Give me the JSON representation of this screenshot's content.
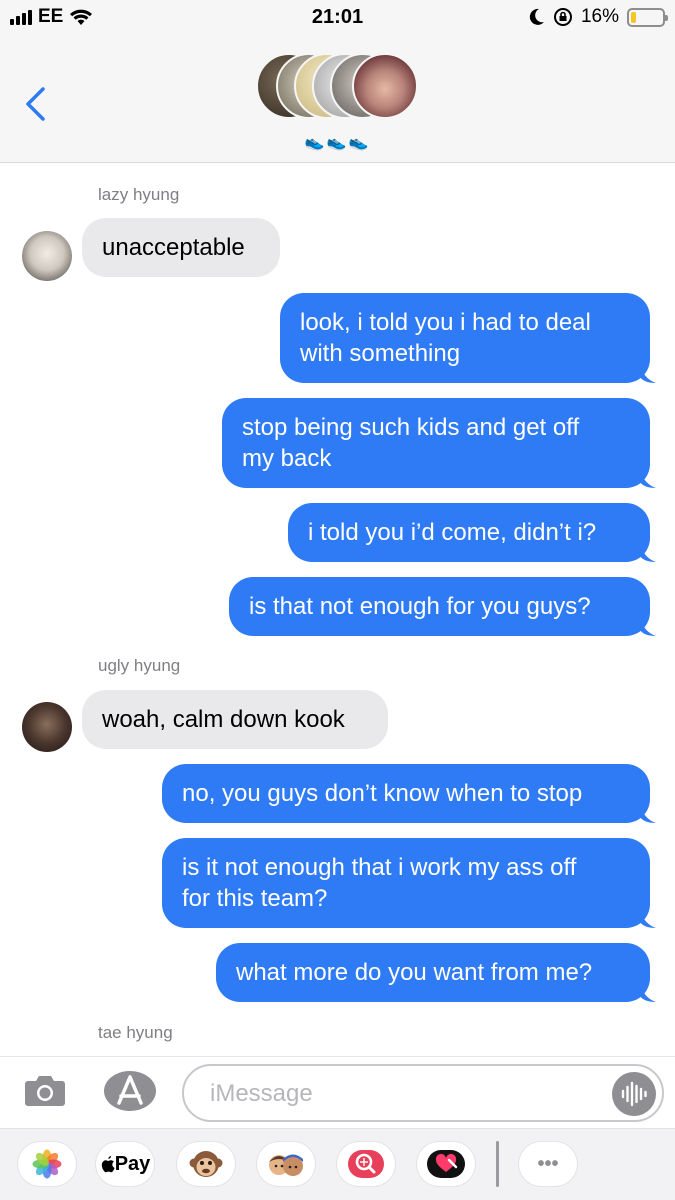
{
  "status_bar": {
    "carrier": "EE",
    "time": "21:01",
    "battery": "16%",
    "battery_level": 0.16
  },
  "header": {
    "group_emoji": "👟👟👟"
  },
  "messages": [
    {
      "sender": "lazy hyung"
    },
    {
      "dir": "in",
      "text": "unacceptable"
    },
    {
      "dir": "out",
      "text": "look, i told you i had to deal\nwith something"
    },
    {
      "dir": "out",
      "text": "stop being such kids and get off\nmy back"
    },
    {
      "dir": "out",
      "text": "i told you i’d come, didn’t i?"
    },
    {
      "dir": "out",
      "text": "is that not enough for you guys?"
    },
    {
      "sender": "ugly hyung"
    },
    {
      "dir": "in",
      "text": "woah, calm down kook"
    },
    {
      "dir": "out",
      "text": "no, you guys don’t know when to stop"
    },
    {
      "dir": "out",
      "text": "is it not enough that i work my ass off\nfor this team?"
    },
    {
      "dir": "out",
      "text": "what more do you want from me?"
    },
    {
      "sender": "tae hyung"
    }
  ],
  "input": {
    "placeholder": "iMessage"
  },
  "drawer": {
    "apple_pay_label": "Pay",
    "more_label": "•••"
  },
  "colors": {
    "outgoing": "#2f7bf5",
    "incoming": "#e9e9eb",
    "accent": "#2f7bf5"
  },
  "icons": [
    "back-chevron-icon",
    "camera-icon",
    "app-store-icon",
    "audio-wave-icon",
    "photos-icon",
    "apple-logo-icon",
    "monkey-emoji-icon",
    "memoji-icon",
    "web-search-icon",
    "heart-icon",
    "more-icon"
  ]
}
